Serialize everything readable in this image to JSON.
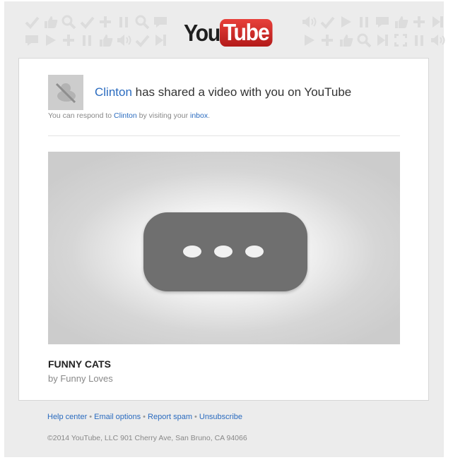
{
  "brand": {
    "logo_you": "You",
    "logo_tube": "Tube",
    "accent": "#cc181e"
  },
  "share": {
    "sender_name": "Clinton",
    "headline_rest": " has shared a video with you on YouTube",
    "respond_prefix": "You can respond to ",
    "respond_sender": "Clinton",
    "respond_middle": " by visiting your ",
    "inbox_link": "inbox",
    "respond_suffix": "."
  },
  "video": {
    "title": "FUNNY CATS",
    "byline": "by Funny Loves"
  },
  "footer": {
    "links": [
      "Help center",
      "Email options",
      "Report spam",
      "Unsubscribe"
    ],
    "separator": "•",
    "copyright": "©2014 YouTube, LLC 901 Cherry Ave, San Bruno, CA 94066"
  },
  "colors": {
    "link": "#2a6bbf",
    "page_bg": "#ececec",
    "pattern_icon": "#dcdcdc"
  }
}
